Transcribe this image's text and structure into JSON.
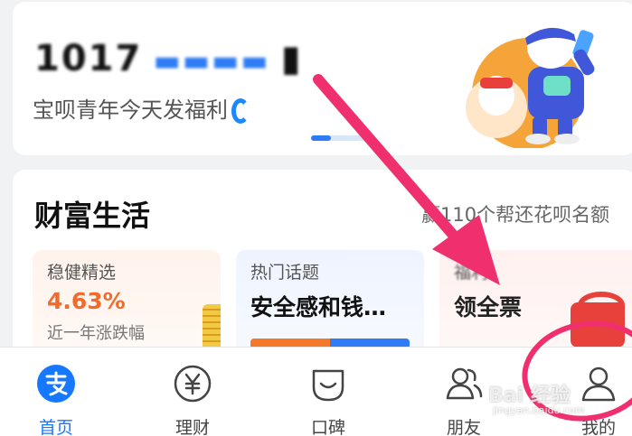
{
  "promo": {
    "title_blurred": "1017",
    "subtitle": "宝呗青年今天发福利"
  },
  "wealth": {
    "title": "财富生活",
    "promo_text": "赢110个帮还花呗名额",
    "tiles": [
      {
        "label": "稳健精选",
        "value": "4.63%",
        "desc": "近一年涨跌幅"
      },
      {
        "label": "热门话题",
        "topic": "安全感和钱…"
      },
      {
        "label": "福利",
        "topic": "领全票"
      }
    ]
  },
  "tabbar": {
    "tabs": [
      {
        "label": "首页",
        "icon": "alipay-icon"
      },
      {
        "label": "理财",
        "icon": "yuan-icon"
      },
      {
        "label": "口碑",
        "icon": "koubei-icon"
      },
      {
        "label": "朋友",
        "icon": "friends-icon"
      },
      {
        "label": "我的",
        "icon": "profile-icon"
      }
    ],
    "active_index": 0
  },
  "colors": {
    "accent_blue": "#1677ff",
    "annotation_pink": "#f0306e",
    "rate_orange": "#f46a2b"
  },
  "watermark": {
    "brand": "Bai 经验",
    "url": "jingyan.baidu.com"
  }
}
